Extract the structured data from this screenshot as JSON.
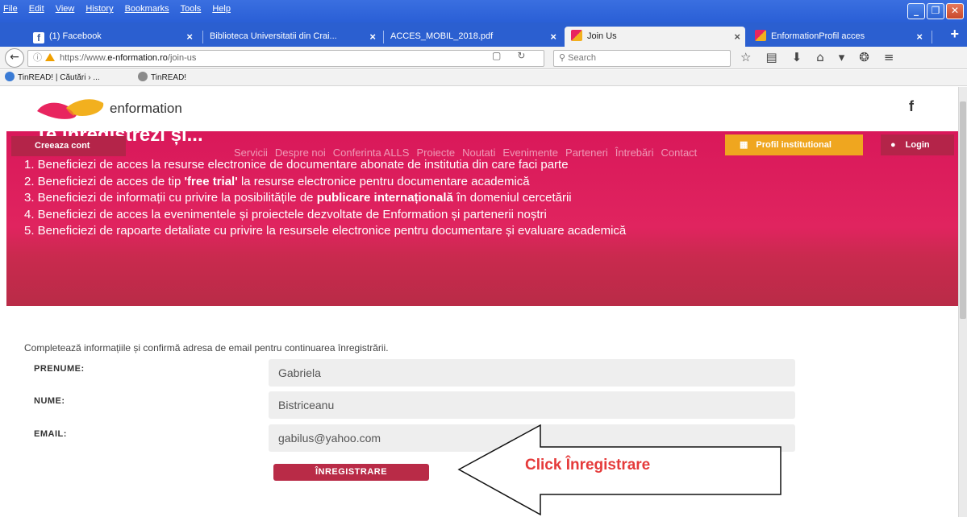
{
  "browser": {
    "menu": [
      "File",
      "Edit",
      "View",
      "History",
      "Bookmarks",
      "Tools",
      "Help"
    ],
    "tabs": [
      {
        "label": "(1) Facebook"
      },
      {
        "label": "Biblioteca Universitatii din Crai..."
      },
      {
        "label": "ACCES_MOBIL_2018.pdf"
      },
      {
        "label": "Join Us"
      },
      {
        "label": "EnformationProfil acces"
      }
    ],
    "url_prefix": "https://www.",
    "url_host": "e-nformation.ro",
    "url_path": "/join-us",
    "search_placeholder": "Search",
    "bookmarks": [
      {
        "label": "TinREAD! | Căutări › ..."
      },
      {
        "label": "TinREAD!"
      }
    ]
  },
  "site": {
    "logo_text": "enformation",
    "facebook_glyph": "f"
  },
  "hero": {
    "title": "Te înregistrezi și...",
    "create_account": "Creeaza cont",
    "nav": [
      "Servicii",
      "Despre noi",
      "Conferinta ALLS",
      "Proiecte",
      "Noutati",
      "Evenimente",
      "Parteneri",
      "Întrebări",
      "Contact"
    ],
    "profile_button": "Profil institutional",
    "login_button": "Login",
    "benefits": [
      {
        "pre": "1. Beneficiezi de acces la resurse electronice de documentare abonate de institutia din care faci parte",
        "bold": "",
        "post": ""
      },
      {
        "pre": "2. Beneficiezi de acces de tip ",
        "bold": "'free trial'",
        "post": " la resurse electronice pentru documentare academică"
      },
      {
        "pre": "3. Beneficiezi de informații cu privire la posibilitățile de ",
        "bold": "publicare internațională",
        "post": " în domeniul cercetării"
      },
      {
        "pre": "4. Beneficiezi de acces la evenimentele și proiectele dezvoltate de Enformation și partenerii noștri",
        "bold": "",
        "post": ""
      },
      {
        "pre": "5. Beneficiezi de rapoarte detaliate cu privire la resursele electronice pentru documentare și evaluare academică",
        "bold": "",
        "post": ""
      }
    ]
  },
  "form": {
    "intro": "Completează informațiile și confirmă adresa de email pentru continuarea înregistrării.",
    "prenume_label": "PRENUME:",
    "prenume_value": "Gabriela",
    "nume_label": "NUME:",
    "nume_value": "Bistriceanu",
    "email_label": "EMAIL:",
    "email_value": "gabilus@yahoo.com",
    "register_button": "ÎNREGISTRARE"
  },
  "annotation": {
    "text": "Click  Înregistrare",
    "color": "#e53a3a"
  }
}
